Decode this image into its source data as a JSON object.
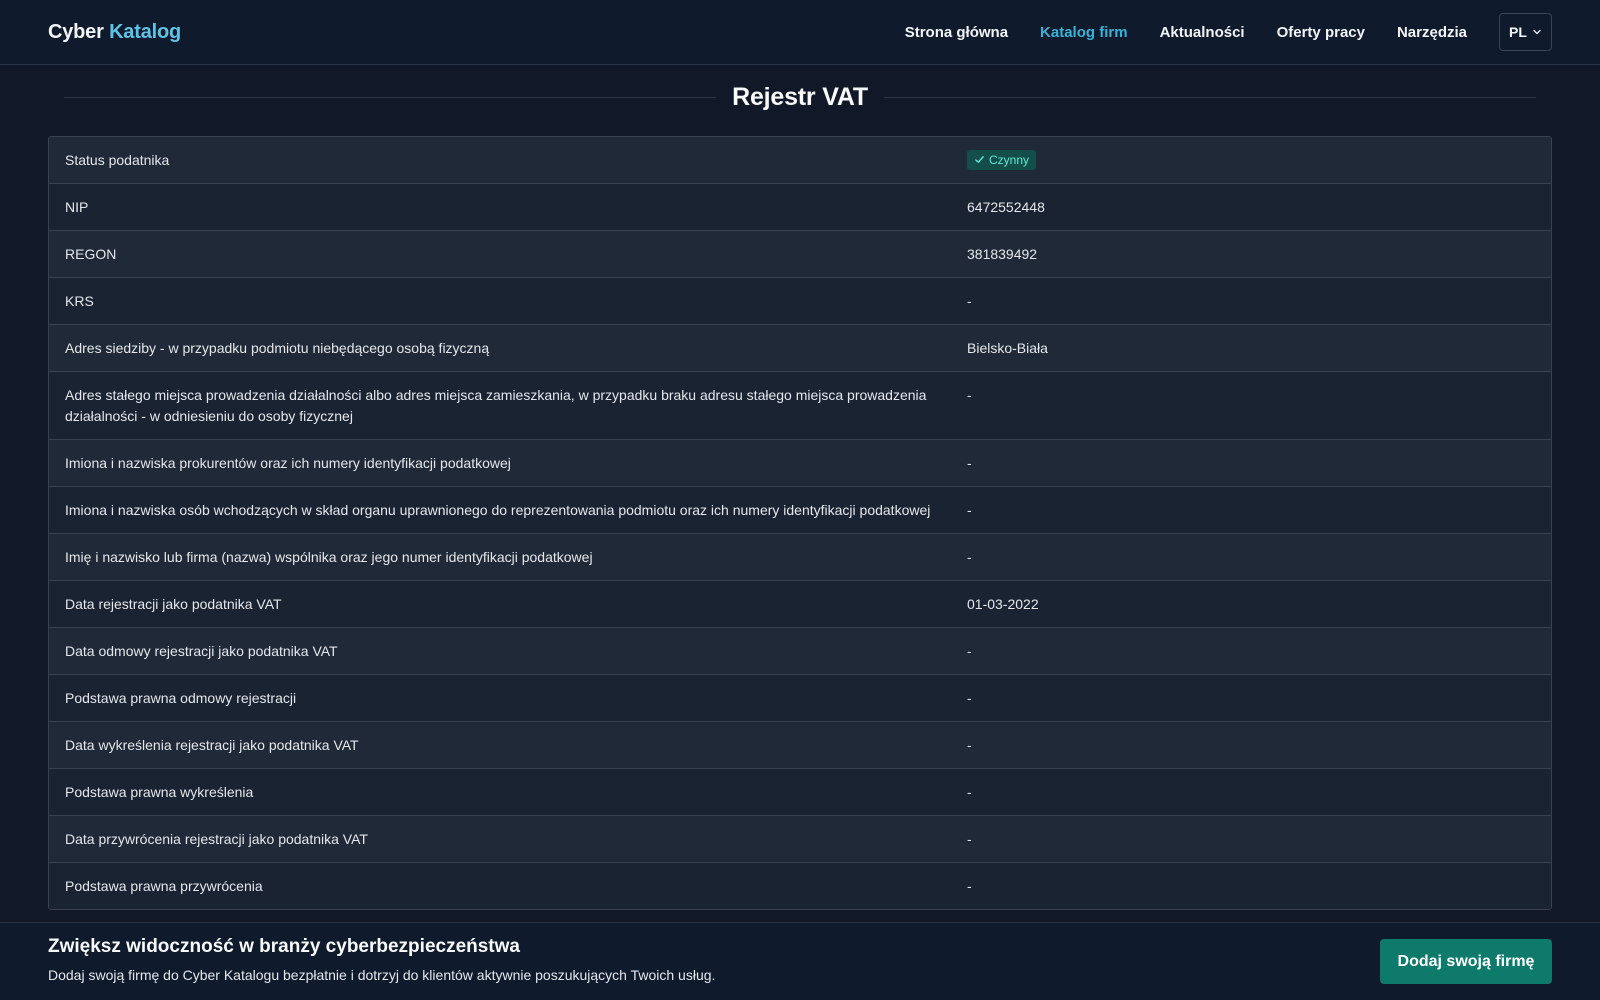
{
  "navbar": {
    "brand_part1": "Cyber",
    "brand_part2": "Katalog",
    "links": [
      "Strona główna",
      "Katalog firm",
      "Aktualności",
      "Oferty pracy",
      "Narzędzia"
    ],
    "active_link": "Katalog firm",
    "language": "PL"
  },
  "section": {
    "title": "Rejestr VAT"
  },
  "vat_register": {
    "status_label": "Status podatnika",
    "status_value": "Czynny",
    "rows": [
      {
        "label": "NIP",
        "value": "6472552448"
      },
      {
        "label": "REGON",
        "value": "381839492"
      },
      {
        "label": "KRS",
        "value": "-"
      },
      {
        "label": "Adres siedziby - w przypadku podmiotu niebędącego osobą fizyczną",
        "value": "Bielsko-Biała"
      },
      {
        "label": "Adres stałego miejsca prowadzenia działalności albo adres miejsca zamieszkania, w przypadku braku adresu stałego miejsca prowadzenia działalności - w odniesieniu do osoby fizycznej",
        "value": "-"
      },
      {
        "label": "Imiona i nazwiska prokurentów oraz ich numery identyfikacji podatkowej",
        "value": "-"
      },
      {
        "label": "Imiona i nazwiska osób wchodzących w skład organu uprawnionego do reprezentowania podmiotu oraz ich numery identyfikacji podatkowej",
        "value": "-"
      },
      {
        "label": "Imię i nazwisko lub firma (nazwa) wspólnika oraz jego numer identyfikacji podatkowej",
        "value": "-"
      },
      {
        "label": "Data rejestracji jako podatnika VAT",
        "value": "01-03-2022"
      },
      {
        "label": "Data odmowy rejestracji jako podatnika VAT",
        "value": "-"
      },
      {
        "label": "Podstawa prawna odmowy rejestracji",
        "value": "-"
      },
      {
        "label": "Data wykreślenia rejestracji jako podatnika VAT",
        "value": "-"
      },
      {
        "label": "Podstawa prawna wykreślenia",
        "value": "-"
      },
      {
        "label": "Data przywrócenia rejestracji jako podatnika VAT",
        "value": "-"
      },
      {
        "label": "Podstawa prawna przywrócenia",
        "value": "-"
      }
    ]
  },
  "banner": {
    "title": "Zwiększ widoczność w branży cyberbezpieczeństwa",
    "description": "Dodaj swoją firmę do Cyber Katalogu bezpłatnie i dotrzyj do klientów aktywnie poszukujących Twoich usług.",
    "cta_label": "Dodaj swoją firmę"
  },
  "colors": {
    "background": "#111827",
    "accent": "#38b2d6",
    "status_active": "#5eead4",
    "cta": "#0d7a6b"
  },
  "icons": {
    "status_badge": "check-icon",
    "language_dropdown": "chevron-down-icon"
  }
}
